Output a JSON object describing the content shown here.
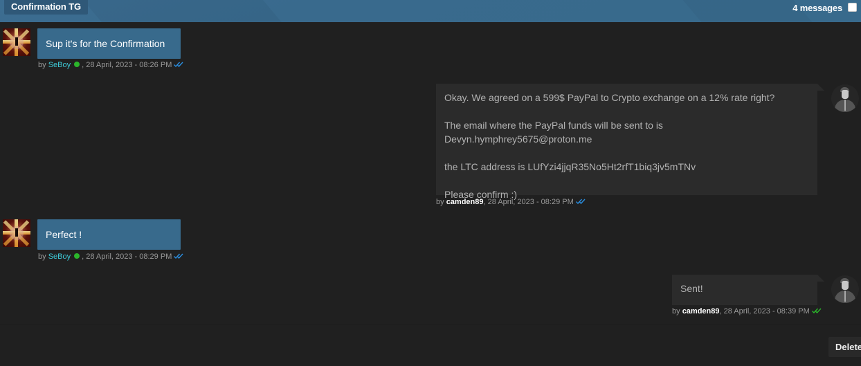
{
  "header": {
    "conversation_title": "Confirmation TG",
    "message_count": "4 messages",
    "brand_color": "#386a8c"
  },
  "messages": [
    {
      "direction": "incoming",
      "author": "SeBoy",
      "online": true,
      "body": [
        "Sup it's for the Confirmation"
      ],
      "by_prefix": "by",
      "timestamp": ", 28 April, 2023 - 08:26 PM",
      "read_status": "read",
      "tick_color": "#2a8ee0"
    },
    {
      "direction": "outgoing",
      "author": "camden89",
      "online": false,
      "body": [
        "Okay. We agreed on a 599$ PayPal to Crypto exchange on a 12% rate right?",
        "The email where the PayPal funds will be sent to is Devyn.hymphrey5675@proton.me",
        "the LTC address is LUfYzi4jjqR35No5Ht2rfT1biq3jv5mTNv",
        "Please confirm :)"
      ],
      "by_prefix": "by",
      "timestamp": ", 28 April, 2023 - 08:29 PM",
      "read_status": "read",
      "tick_color": "#2a8ee0"
    },
    {
      "direction": "incoming",
      "author": "SeBoy",
      "online": true,
      "body": [
        "Perfect !"
      ],
      "by_prefix": "by",
      "timestamp": ", 28 April, 2023 - 08:29 PM",
      "read_status": "read",
      "tick_color": "#2a8ee0"
    },
    {
      "direction": "outgoing",
      "author": "camden89",
      "online": false,
      "body": [
        "Sent!"
      ],
      "by_prefix": "by",
      "timestamp": ", 28 April, 2023 - 08:39 PM",
      "read_status": "delivered",
      "tick_color": "#2bb52b"
    }
  ],
  "icons": {
    "incoming_avatar": "avatar-image",
    "outgoing_avatar": "default-user-silhouette",
    "online_status": "green-dot",
    "read_receipt": "double-check"
  },
  "actions": {
    "delete_label": "Delete"
  }
}
